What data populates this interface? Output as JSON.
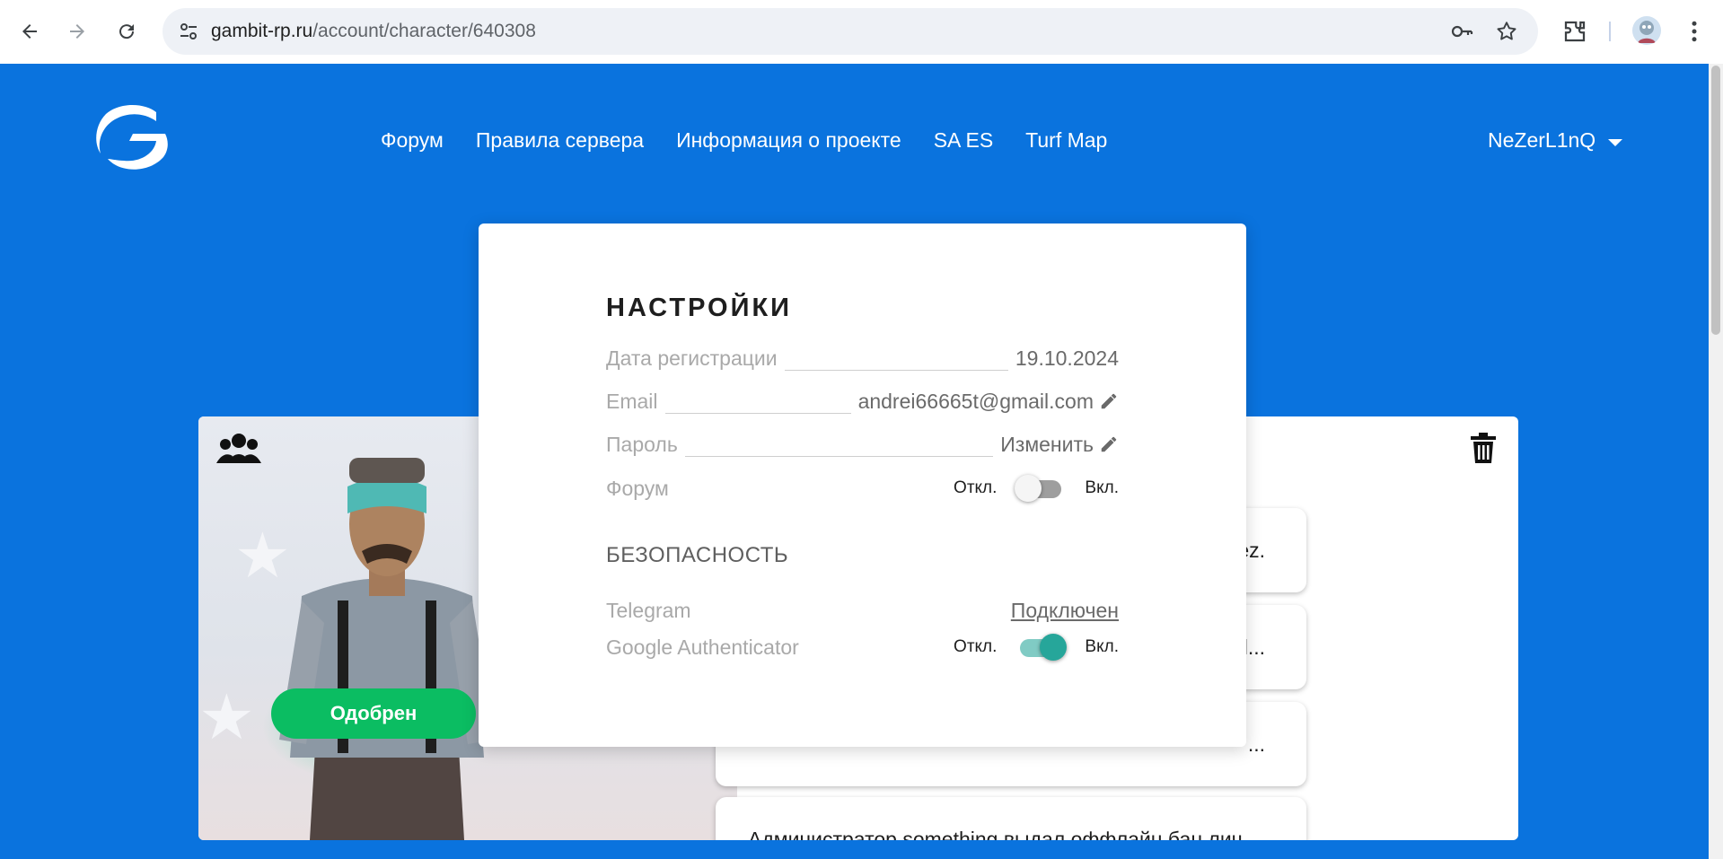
{
  "browser": {
    "url_host": "gambit-rp.ru",
    "url_path": "/account/character/640308"
  },
  "header": {
    "nav": [
      {
        "label": "Форум"
      },
      {
        "label": "Правила сервера"
      },
      {
        "label": "Информация о проекте"
      },
      {
        "label": "SA ES"
      },
      {
        "label": "Turf Map"
      }
    ],
    "username": "NeZerL1nQ"
  },
  "character": {
    "status_label": "Одобрен",
    "logs": [
      {
        "text": "ez."
      },
      {
        "text": "l..."
      },
      {
        "text": "..."
      },
      {
        "text": "Администратор something выдал оффлайн бан лич..."
      }
    ]
  },
  "settings": {
    "title": "НАСТРОЙКИ",
    "registration_label": "Дата регистрации",
    "registration_value": "19.10.2024",
    "email_label": "Email",
    "email_value": "andrei66665t@gmail.com",
    "password_label": "Пароль",
    "password_action": "Изменить",
    "forum_label": "Форум",
    "forum_off": "Откл.",
    "forum_on": "Вкл.",
    "forum_enabled": false,
    "security_title": "БЕЗОПАСНОСТЬ",
    "telegram_label": "Telegram",
    "telegram_value": "Подключен",
    "ga_label": "Google Authenticator",
    "ga_off": "Откл.",
    "ga_on": "Вкл.",
    "ga_enabled": true
  },
  "colors": {
    "brand_blue": "#0a73de",
    "approved_green": "#0bbd62",
    "toggle_teal": "#26a69a"
  }
}
